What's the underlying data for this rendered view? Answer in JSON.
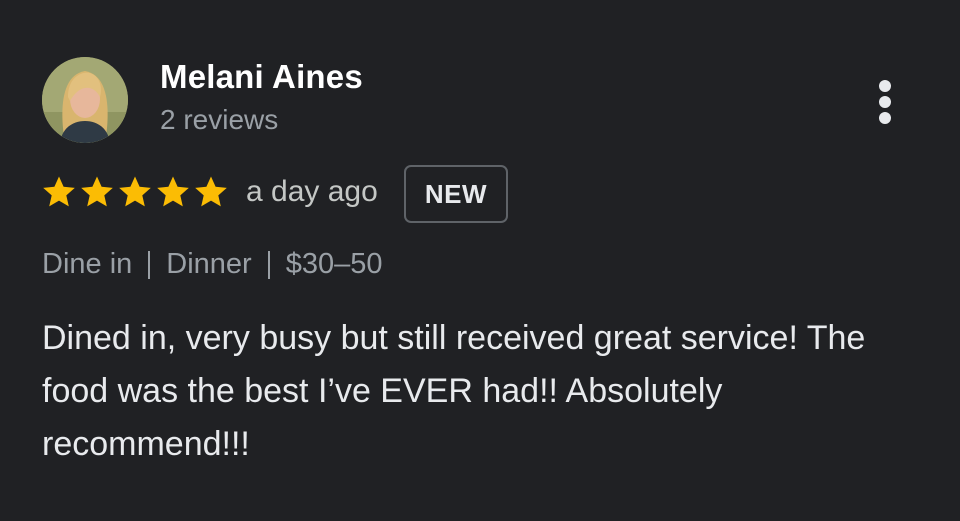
{
  "reviewer": {
    "name": "Melani Aines",
    "reviews_count": "2 reviews"
  },
  "rating": {
    "stars": 5,
    "max_stars": 5,
    "star_color": "#fbbc04"
  },
  "time_ago": "a day ago",
  "badge": "NEW",
  "meta": {
    "service": "Dine in",
    "meal": "Dinner",
    "price": "$30–50"
  },
  "review_text": "Dined in, very busy but still received great service! The food was the best I’ve EVER had!! Absolutely recommend!!!",
  "icons": {
    "menu": "more-vert-icon",
    "star": "star-icon"
  }
}
